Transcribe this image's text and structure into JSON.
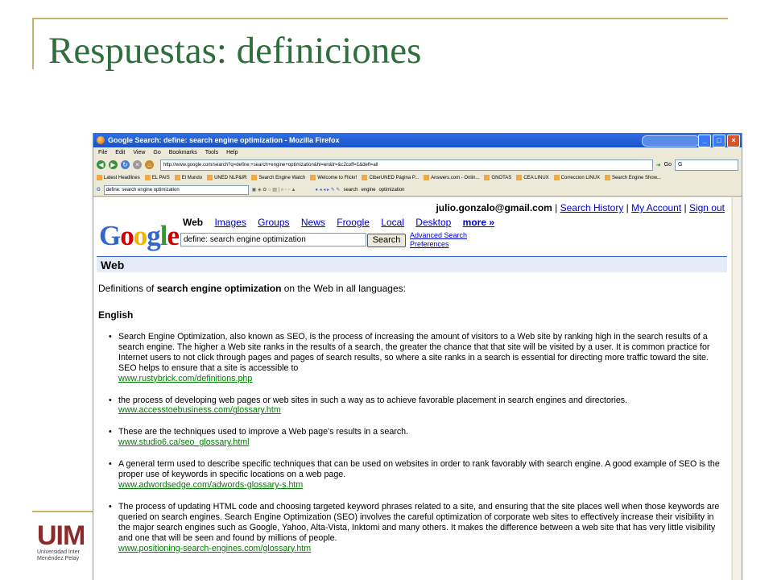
{
  "slide": {
    "title": "Respuestas: definiciones"
  },
  "logo": {
    "text": "UIM",
    "subtitle": "Universidad Inter\nMenéndez Pelay"
  },
  "browser": {
    "window_title": "Google Search: define: search engine optimization - Mozilla Firefox",
    "menu": [
      "File",
      "Edit",
      "View",
      "Go",
      "Bookmarks",
      "Tools",
      "Help"
    ],
    "url": "http://www.google.com/search?q=define:+search+engine+optimization&hl=en&lr=&c2coff=1&defl=all",
    "go_label": "Go",
    "bookmarks": [
      "Latest Headlines",
      "EL PAIS",
      "El Mundo",
      "UNED NLP&IR",
      "Search Engine Watch",
      "Welcome to Flickr!",
      "CiberUNED Página P...",
      "Answers.com - Onlin...",
      "GNOTAS",
      "CEA LINUX",
      "Correccion LINUX",
      "Search Engine Show..."
    ],
    "gtoolbar_query": "define: search engine optimization",
    "gtoolbar_words": [
      "search",
      "engine",
      "optimization"
    ]
  },
  "google": {
    "email": "julio.gonzalo@gmail.com",
    "links": [
      "Search History",
      "My Account",
      "Sign out"
    ],
    "logo": "Google",
    "tabs_active": "Web",
    "tabs": [
      "Images",
      "Groups",
      "News",
      "Froogle",
      "Local",
      "Desktop"
    ],
    "more": "more »",
    "query": "define: search engine optimization",
    "search_button": "Search",
    "advanced": "Advanced Search",
    "preferences": "Preferences",
    "section": "Web",
    "definitions_prefix": "Definitions of ",
    "definitions_term": "search engine optimization",
    "definitions_suffix": " on the Web in all languages:",
    "language": "English",
    "definitions": [
      {
        "text": "Search Engine Optimization, also known as SEO, is the process of increasing the amount of visitors to a Web site by ranking high in the search results of a search engine. The higher a Web site ranks in the results of a search, the greater the chance that that site will be visited by a user. It is common practice for Internet users to not click through pages and pages of search results, so where a site ranks in a search is essential for directing more traffic toward the site. SEO helps to ensure that a site is accessible to",
        "source": "www.rustybrick.com/definitions.php"
      },
      {
        "text": "the process of developing web pages or web sites in such a way as to achieve favorable placement in search engines and directories.",
        "source": "www.accesstoebusiness.com/glossary.htm"
      },
      {
        "text": "These are the techniques used to improve a Web page's results in a search.",
        "source": "www.studio6.ca/seo_glossary.html"
      },
      {
        "text": "A general term used to describe specific techniques that can be used on websites in order to rank favorably with search engine. A good example of SEO is the proper use of keywords in specific locations on a web page.",
        "source": "www.adwordsedge.com/adwords-glossary-s.htm"
      },
      {
        "text": "The process of updating HTML code and choosing targeted keyword phrases related to a site, and ensuring that the site places well when those keywords are queried on search engines. Search Engine Optimization (SEO) involves the careful optimization of corporate web sites to effectively increase their visibility in the major search engines such as Google, Yahoo, Alta-Vista, Inktomi and many others. It makes the difference between a web site that has very little visibility and one that will be seen and found by millions of people.",
        "source": "www.positioning-search-engines.com/glossary.htm"
      }
    ]
  },
  "colors": {
    "title_green": "#2e6e3a",
    "frame_gold": "#c9b36a",
    "link_blue": "#0000cc",
    "source_green": "#008000"
  }
}
